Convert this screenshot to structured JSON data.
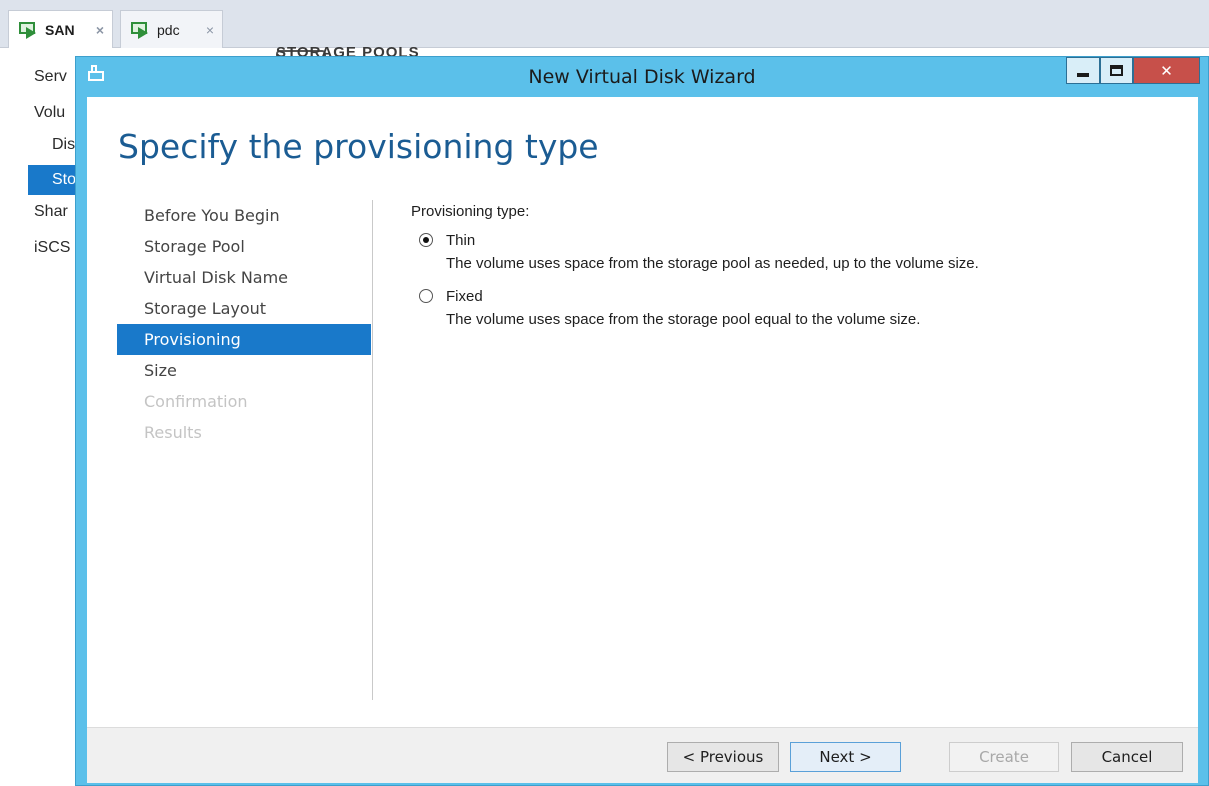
{
  "host_tabs": [
    {
      "label": "SAN",
      "close": "×"
    },
    {
      "label": "pdc",
      "close": "×"
    }
  ],
  "background": {
    "section_heading": "STORAGE POOLS",
    "nav": [
      "Serv",
      "Volu",
      "Dis",
      "Sto",
      "Shar",
      "iSCS"
    ]
  },
  "wizard": {
    "window_title": "New Virtual Disk Wizard",
    "page_title": "Specify the provisioning type",
    "steps": [
      {
        "label": "Before You Begin",
        "state": "normal"
      },
      {
        "label": "Storage Pool",
        "state": "normal"
      },
      {
        "label": "Virtual Disk Name",
        "state": "normal"
      },
      {
        "label": "Storage Layout",
        "state": "normal"
      },
      {
        "label": "Provisioning",
        "state": "active"
      },
      {
        "label": "Size",
        "state": "normal"
      },
      {
        "label": "Confirmation",
        "state": "disabled"
      },
      {
        "label": "Results",
        "state": "disabled"
      }
    ],
    "provisioning": {
      "label": "Provisioning type:",
      "options": [
        {
          "label": "Thin",
          "description": "The volume uses space from the storage pool as needed, up to the volume size.",
          "selected": true
        },
        {
          "label": "Fixed",
          "description": "The volume uses space from the storage pool equal to the volume size.",
          "selected": false
        }
      ]
    },
    "buttons": {
      "previous": "< Previous",
      "next": "Next >",
      "create": "Create",
      "cancel": "Cancel"
    }
  },
  "colors": {
    "title_bar": "#5bc0ea",
    "accent": "#1979ca",
    "close_button": "#c7504a",
    "page_title": "#1b5c93"
  }
}
